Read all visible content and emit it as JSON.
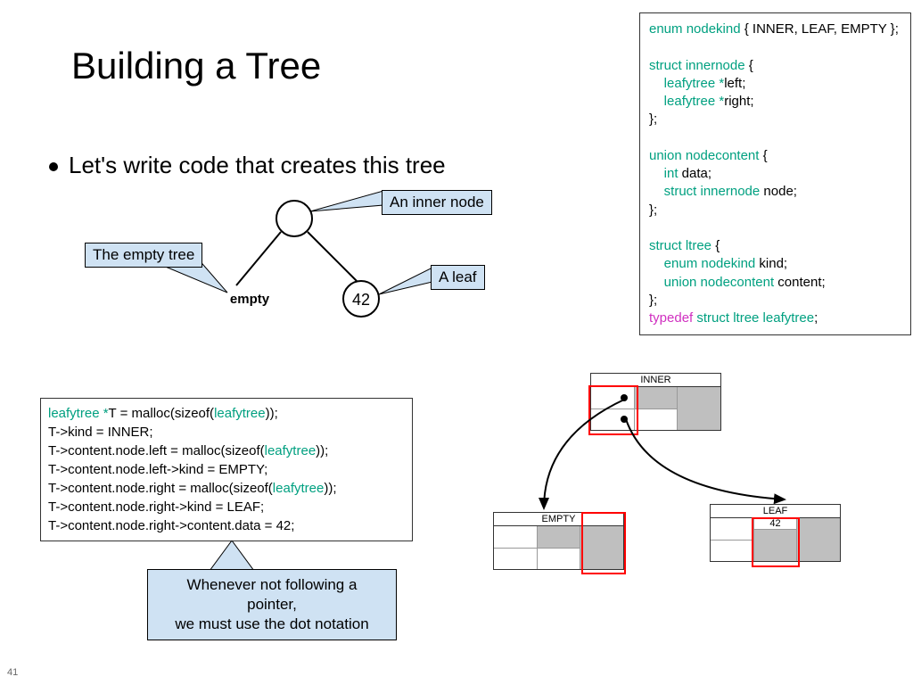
{
  "title": "Building a Tree",
  "bullet": "Let's write code that creates this tree",
  "callouts": {
    "empty_tree": "The empty tree",
    "inner_node": "An inner node",
    "leaf": "A leaf"
  },
  "tree": {
    "empty_label": "empty",
    "leaf_value": "42"
  },
  "typedef_code": {
    "l1a": "enum nodekind",
    "l1b": " { INNER, LEAF, EMPTY };",
    "l2a": "struct innernode",
    "l2b": " {",
    "l3a": "leafytree *",
    "l3b": "left;",
    "l4a": "leafytree *",
    "l4b": "right;",
    "l5": " };",
    "l6a": "union nodecontent",
    "l6b": " {",
    "l7a": "int",
    "l7b": " data;",
    "l8a": "struct innernode",
    "l8b": " node;",
    "l9": " };",
    "l10a": "struct ltree",
    "l10b": " {",
    "l11a": "enum nodekind",
    "l11b": " kind;",
    "l12a": "union nodecontent",
    "l12b": " content;",
    "l13": "};",
    "l14a": "typedef ",
    "l14b": "struct ltree leafytree",
    "l14c": ";"
  },
  "build_code": {
    "l1a": "leafytree *",
    "l1b": "T = malloc(sizeof(",
    "l1c": "leafytree",
    "l1d": "));",
    "l2": "T->kind = INNER;",
    "l3a": "T->content.node.left = malloc(sizeof(",
    "l3b": "leafytree",
    "l3c": "));",
    "l4": "T->content.node.left->kind = EMPTY;",
    "l5a": "T->content.node.right = malloc(sizeof(",
    "l5b": "leafytree",
    "l5c": "));",
    "l6": "T->content.node.right->kind = LEAF;",
    "l7": "T->content.node.right->content.data = 42;"
  },
  "note": {
    "line1": "Whenever not following a pointer,",
    "line2": "we must use the dot notation"
  },
  "mem": {
    "inner": "INNER",
    "empty": "EMPTY",
    "leaf": "LEAF",
    "leaf_value": "42"
  },
  "pagenum": "41"
}
